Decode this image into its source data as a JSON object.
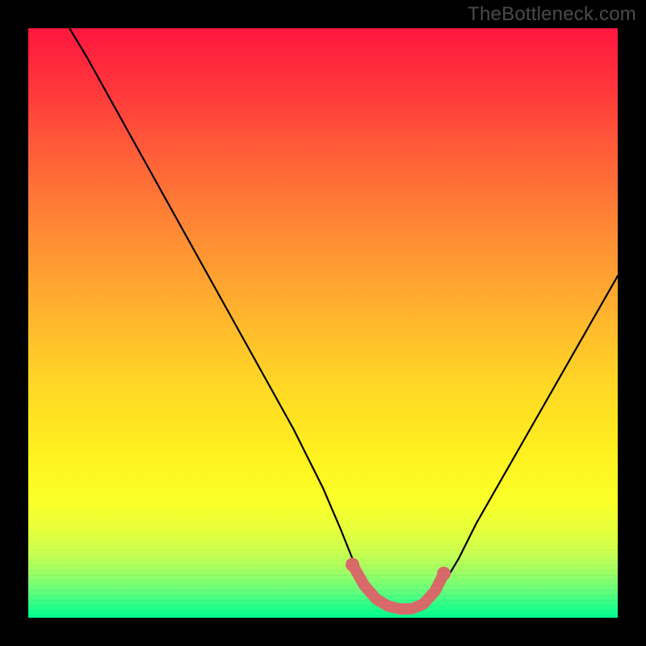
{
  "watermark": "TheBottleneck.com",
  "chart_data": {
    "type": "line",
    "title": "",
    "xlabel": "",
    "ylabel": "",
    "xlim": [
      0,
      100
    ],
    "ylim": [
      0,
      100
    ],
    "series": [
      {
        "name": "bottleneck-curve",
        "x": [
          7,
          10,
          15,
          20,
          25,
          30,
          35,
          40,
          45,
          50,
          53,
          55,
          57,
          60,
          63,
          66,
          68,
          70,
          73,
          76,
          80,
          84,
          88,
          92,
          96,
          100
        ],
        "y": [
          100,
          95,
          86,
          77,
          68,
          59,
          50,
          41,
          32,
          22,
          15,
          10,
          6,
          3,
          1.5,
          1.5,
          2.5,
          5,
          10,
          16,
          23,
          30,
          37,
          44,
          51,
          58
        ]
      }
    ],
    "highlight": {
      "name": "optimal-region",
      "color": "#d96a6a",
      "x": [
        55,
        57,
        59,
        61,
        63,
        65,
        67,
        69,
        70.5
      ],
      "y": [
        9,
        5.5,
        3.2,
        2.0,
        1.5,
        1.5,
        2.3,
        4.5,
        7.5
      ]
    },
    "gradient_meaning": "background hue encodes bottleneck severity: red = high, green = low"
  }
}
